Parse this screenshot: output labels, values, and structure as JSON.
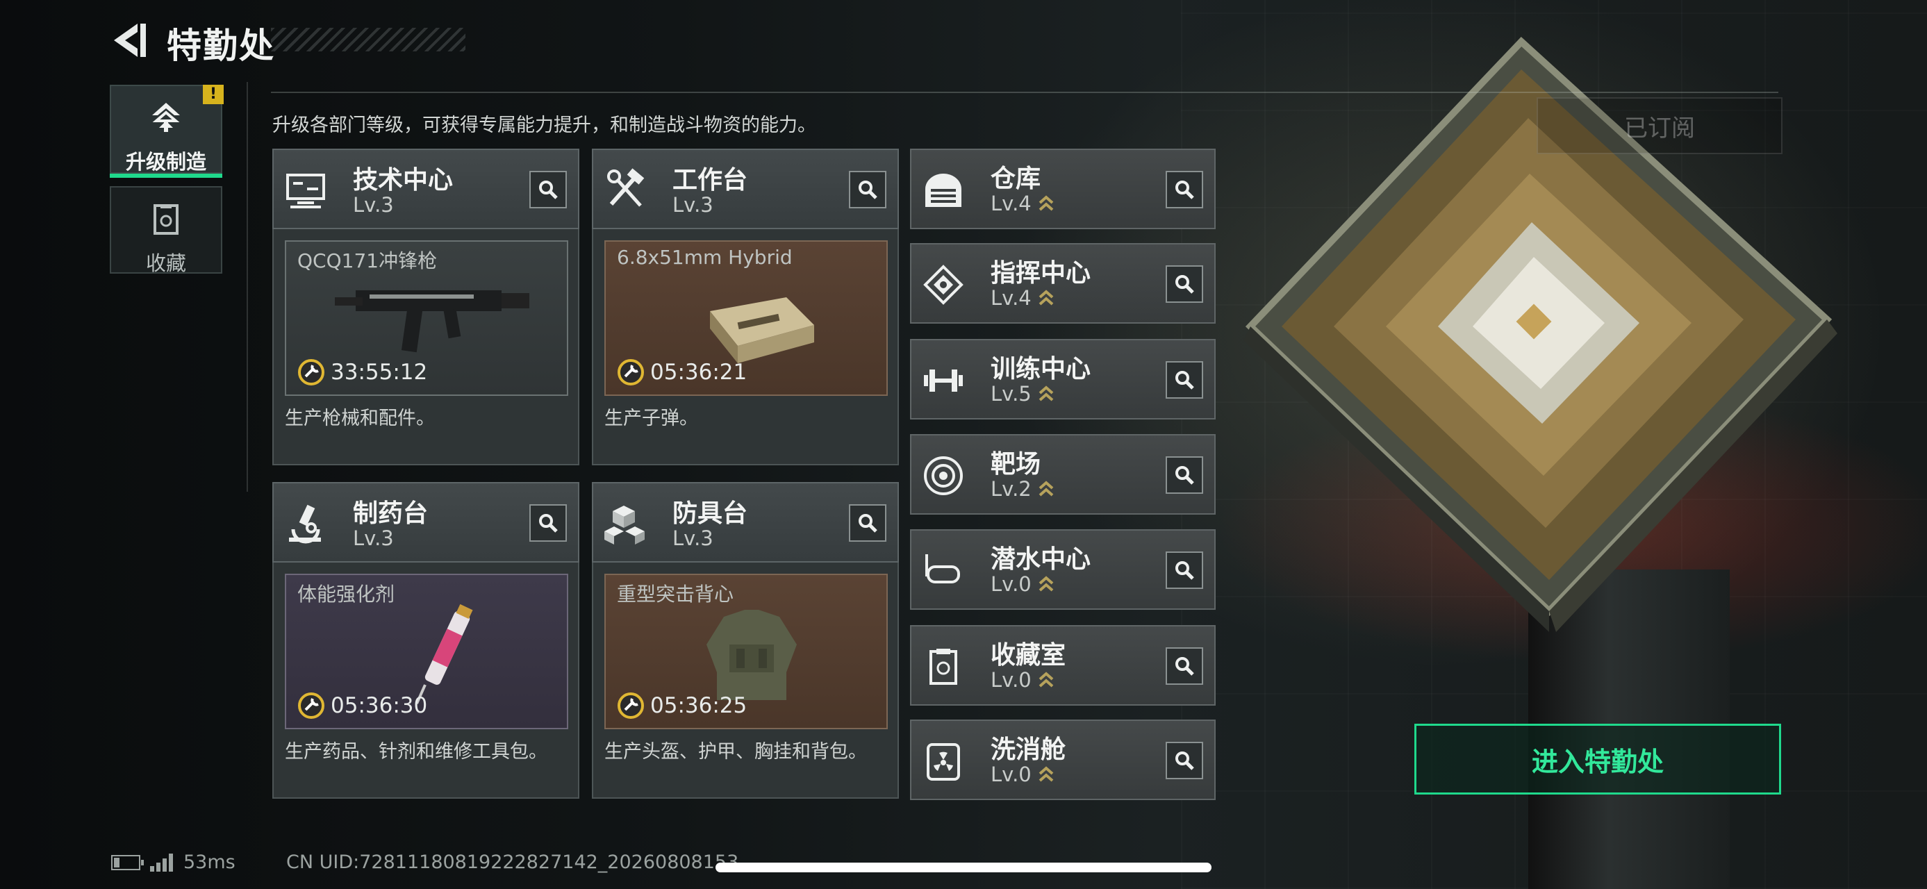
{
  "header": {
    "title": "特勤处"
  },
  "description": "升级各部门等级，可获得专属能力提升，和制造战斗物资的能力。",
  "subscribed_label": "已订阅",
  "nav": {
    "items": [
      {
        "label": "升级制造",
        "badge": "!",
        "active": true
      },
      {
        "label": "收藏",
        "active": false
      }
    ]
  },
  "cards": [
    {
      "name": "技术中心",
      "level": "Lv.3",
      "product": "QCQ171冲锋枪",
      "timer": "33:55:12",
      "desc": "生产枪械和配件。",
      "icon": "monitor-icon"
    },
    {
      "name": "工作台",
      "level": "Lv.3",
      "product": "6.8x51mm Hybrid",
      "timer": "05:36:21",
      "desc": "生产子弹。",
      "icon": "tools-icon"
    },
    {
      "name": "制药台",
      "level": "Lv.3",
      "product": "体能强化剂",
      "timer": "05:36:30",
      "desc": "生产药品、针剂和维修工具包。",
      "icon": "microscope-icon"
    },
    {
      "name": "防具台",
      "level": "Lv.3",
      "product": "重型突击背心",
      "timer": "05:36:25",
      "desc": "生产头盔、护甲、胸挂和背包。",
      "icon": "armor-boxes-icon"
    }
  ],
  "facilities": [
    {
      "name": "仓库",
      "level": "Lv.4",
      "icon": "warehouse-icon"
    },
    {
      "name": "指挥中心",
      "level": "Lv.4",
      "icon": "chip-icon"
    },
    {
      "name": "训练中心",
      "level": "Lv.5",
      "icon": "dumbbell-icon"
    },
    {
      "name": "靶场",
      "level": "Lv.2",
      "icon": "target-icon"
    },
    {
      "name": "潜水中心",
      "level": "Lv.0",
      "icon": "dive-mask-icon"
    },
    {
      "name": "收藏室",
      "level": "Lv.0",
      "icon": "collection-icon"
    },
    {
      "name": "洗消舱",
      "level": "Lv.0",
      "icon": "radiation-icon"
    }
  ],
  "enter_button": "进入特勤处",
  "footer": {
    "ping": "53ms",
    "uid": "CN UID:7281118081922282714​2_20260808153"
  },
  "colors": {
    "accent": "#1fd98c",
    "upgrade_chevron": "#b6a25c",
    "warning": "#d7b31d"
  }
}
